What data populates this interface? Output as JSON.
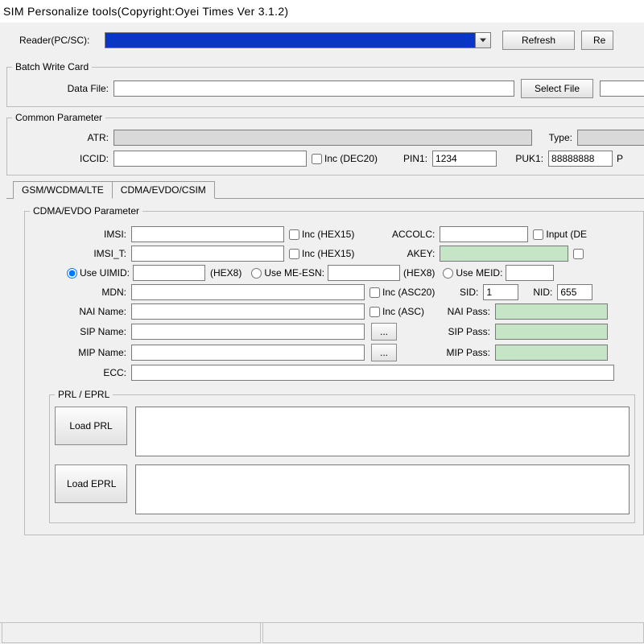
{
  "title": "SIM Personalize tools(Copyright:Oyei Times Ver 3.1.2)",
  "reader": {
    "label": "Reader(PC/SC):",
    "refresh": "Refresh",
    "re": "Re"
  },
  "batch": {
    "legend": "Batch Write Card",
    "datafile_label": "Data File:",
    "select_file": "Select File",
    "datafile": ""
  },
  "common": {
    "legend": "Common Parameter",
    "atr_label": "ATR:",
    "atr": "",
    "type_label": "Type:",
    "type": "",
    "iccid_label": "ICCID:",
    "iccid": "",
    "inc_dec20": "Inc  (DEC20)",
    "pin1_label": "PIN1:",
    "pin1": "1234",
    "puk1_label": "PUK1:",
    "puk1": "88888888",
    "p": "P"
  },
  "tabs": {
    "t1": "GSM/WCDMA/LTE",
    "t2": "CDMA/EVDO/CSIM"
  },
  "cdma": {
    "legend": "CDMA/EVDO Parameter",
    "imsi_label": "IMSI:",
    "imsi": "",
    "imsi_inc": "Inc  (HEX15)",
    "accolc_label": "ACCOLC:",
    "accolc": "",
    "input_de": "Input  (DE",
    "imsi_t_label": "IMSI_T:",
    "imsi_t": "",
    "imsi_t_inc": "Inc  (HEX15)",
    "akey_label": "AKEY:",
    "akey": "",
    "use_uimid": "Use UIMID:",
    "uimid": "",
    "hex8": "(HEX8)",
    "use_meesn": "Use ME-ESN:",
    "meesn": "",
    "use_meid": "Use MEID:",
    "meid": "",
    "mdn_label": "MDN:",
    "mdn": "",
    "mdn_inc": "Inc  (ASC20)",
    "sid_label": "SID:",
    "sid": "1",
    "nid_label": "NID:",
    "nid": "655",
    "nai_name_label": "NAI Name:",
    "nai_name": "",
    "nai_inc": "Inc  (ASC)",
    "nai_pass_label": "NAI Pass:",
    "nai_pass": "",
    "sip_name_label": "SIP Name:",
    "sip_name": "",
    "dots": "...",
    "sip_pass_label": "SIP Pass:",
    "sip_pass": "",
    "mip_name_label": "MIP Name:",
    "mip_name": "",
    "mip_pass_label": "MIP Pass:",
    "mip_pass": "",
    "ecc_label": "ECC:",
    "ecc": ""
  },
  "prl": {
    "legend": "PRL / EPRL",
    "load_prl": "Load PRL",
    "load_eprl": "Load EPRL"
  }
}
